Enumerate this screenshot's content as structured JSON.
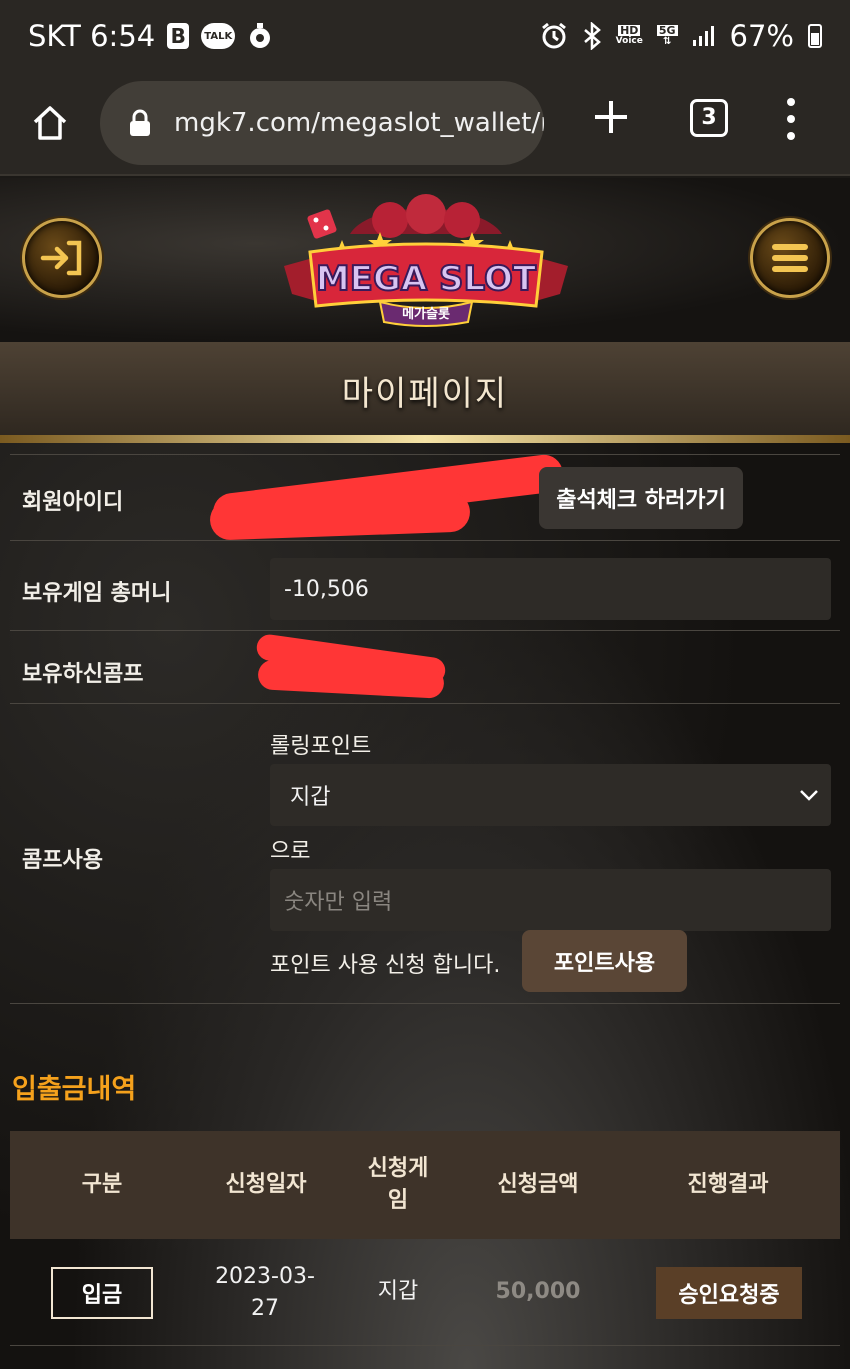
{
  "status_bar": {
    "carrier_time": "SKT 6:54",
    "app_badge_b": "B",
    "app_badge_talk": "TALK",
    "hd_voice_top": "HD",
    "hd_voice_bottom": "Voice",
    "network": "5G",
    "battery": "67%"
  },
  "browser": {
    "url": "mgk7.com/megaslot_wallet/m",
    "tab_count": "3"
  },
  "header": {
    "logo_text": "MEGA SLOT",
    "logo_subtext": "메가슬롯"
  },
  "page_title": "마이페이지",
  "profile": {
    "member_id_label": "회원아이디",
    "attendance_button": "출석체크 하러가기",
    "game_money_label": "보유게임 총머니",
    "game_money_value": "-10,506",
    "comp_label": "보유하신콤프",
    "comp_use_label": "콤프사용",
    "rolling_point_label": "롤링포인트",
    "wallet_select_value": "지갑",
    "to_text": "으로",
    "amount_placeholder": "숫자만 입력",
    "request_text": "포인트 사용 신청 합니다.",
    "use_points_button": "포인트사용"
  },
  "history": {
    "title": "입출금내역",
    "columns": [
      "구분",
      "신청일자",
      "신청게임",
      "신청금액",
      "진행결과"
    ],
    "rows": [
      {
        "type": "입금",
        "date": "2023-03-27",
        "game": "지갑",
        "amount": "50,000",
        "status": "승인요청중"
      }
    ]
  },
  "colors": {
    "accent_orange": "#f5a11c",
    "gold": "#c9a24a",
    "redaction": "#ff3636"
  }
}
